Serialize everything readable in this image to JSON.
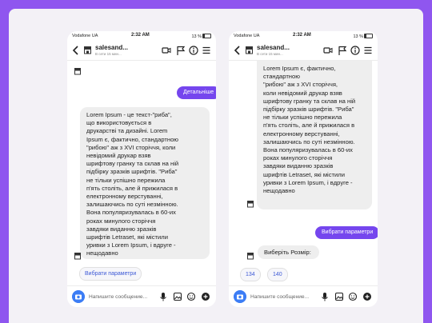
{
  "status_bar": {
    "carrier": "Vodafone UA",
    "time": "2:32 AM",
    "battery": "13 %"
  },
  "chat": {
    "name": "salesand...",
    "status": "В сети 15 мин..."
  },
  "messages": {
    "bot_text": "Lorem Ipsum - це текст-\"риба\",\nщо використовується в\nдрукарстві та дизайні. Lorem\nIpsum є, фактично, стандартною\n\"рибою\" аж з XVI сторіччя, коли\nневідомий друкар взяв\nшрифтову гранку та склав на ній\nпідбірку зразків шрифтів. \"Риба\"\nне тільки успішно пережила\nп'ять століть, але й прижилася в\nелектронному верстуванні,\nзалишаючись по суті незмінною.\nВона популяризувалась в 60-их\nроках минулого сторіччя\nзавдяки виданню зразків\nшрифтів Letraset, які містили\nуривки з Lorem Ipsum, і вдруге -\nнещодавно",
    "bot_text_cont": "Lorem Ipsum є, фактично,\nстандартною\n\"рибою\" аж з XVI сторіччя,\nколи невідомий друкар взяв\nшрифтову гранку та склав на ній\nпідбірку зразків шрифтів. \"Риба\"\nне тільки успішно пережила\nп'ять століть, але й прижилася в\nелектронному верстуванні,\nзалишаючись по суті незмінною.\nВона популяризувалась в 60-их\nроках минулого сторіччя\nзавдяки виданню зразків\nшрифтів Letraset, які містили\nуривки з Lorem Ipsum, і вдруге -\nнещодавно",
    "details_button": "Детальніше",
    "choose_params_quick": "Вибрати параметри",
    "choose_params_sent": "Вибрати параметри",
    "choose_size": "Виберіть Розмір:",
    "size_options": [
      "134",
      "140"
    ]
  },
  "composer": {
    "placeholder": "Напишите сообщение..."
  },
  "colors": {
    "accent": "#7546ee",
    "frame": "#8f56ef",
    "link": "#3d59d6",
    "camera": "#3c7df5"
  },
  "icons": [
    "back-icon",
    "store-icon",
    "video-icon",
    "flag-icon",
    "info-icon",
    "menu-icon",
    "camera-icon",
    "microphone-icon",
    "gallery-icon",
    "sticker-icon",
    "plus-icon",
    "battery-icon"
  ]
}
